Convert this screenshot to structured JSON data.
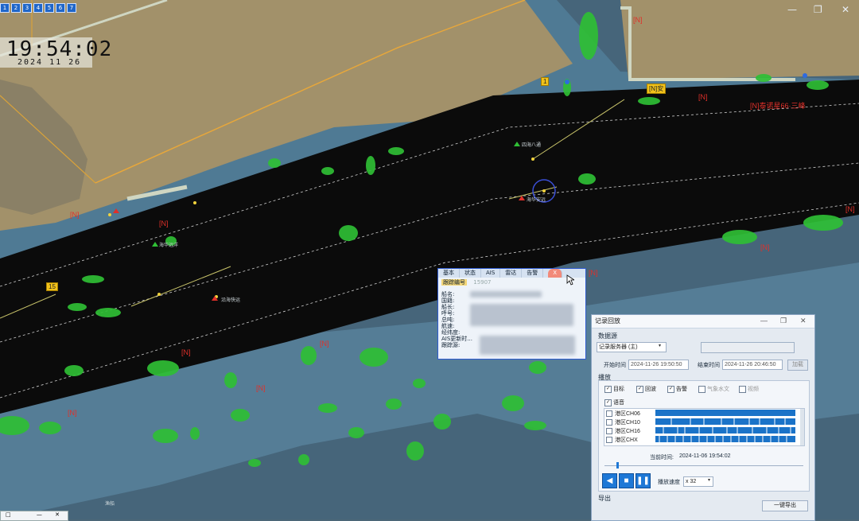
{
  "clock": {
    "time": "19:54:02",
    "date": "2024  11  26"
  },
  "toolbar": {
    "buttons": [
      "1",
      "2",
      "3",
      "4",
      "5",
      "6",
      "7"
    ]
  },
  "window_controls": {
    "minimize": "—",
    "restore": "❐",
    "close": "✕"
  },
  "map_labels": {
    "n": "[N]",
    "n_caption": "[N]泰诺星66·三峰",
    "y1": "[N]安",
    "y2": "15",
    "y3": "1",
    "t1": "四海八通",
    "t2": "海华安远",
    "t3": "海华远洋",
    "t4": "沿海快运",
    "t5": "渔船"
  },
  "popup": {
    "tabs": [
      "基本",
      "状态",
      "AIS",
      "雷达",
      "告警",
      "X"
    ],
    "id_label": "跟踪编号",
    "id_value": "15907",
    "fields": [
      "船名:",
      "国籍:",
      "船长:",
      "呼号:",
      "总吨:",
      "航速:",
      "",
      "经纬度:",
      "AIS更新时...",
      "跟踪源:"
    ]
  },
  "playback": {
    "title": "记录回放",
    "source_section": "数据源",
    "source_value": "记录服务器 (主)",
    "start_label": "开始时间",
    "start_value": "2024-11-26 19:50:50",
    "end_label": "结束时间",
    "end_value": "2024-11-26 20:46:50",
    "load_button": "加载",
    "play_section": "播放",
    "options": [
      {
        "label": "目标",
        "checked": true,
        "enabled": true
      },
      {
        "label": "回波",
        "checked": true,
        "enabled": true
      },
      {
        "label": "告警",
        "checked": true,
        "enabled": true
      },
      {
        "label": "气象水文",
        "checked": false,
        "enabled": false
      },
      {
        "label": "视频",
        "checked": false,
        "enabled": false
      }
    ],
    "voice_label": "语音",
    "voice_checked": true,
    "channels": [
      "港区CH06",
      "港区CH10",
      "港区CH16",
      "港区CHX"
    ],
    "current_time_label": "当前时间:",
    "current_time_value": "2024-11-06  19:54:02",
    "play_progress": 0.06,
    "speed_label": "播放速度",
    "speed_value": "x 32",
    "export_section": "导出",
    "export_button": "一键导出",
    "colors": {
      "accent": "#1e78d6",
      "bar": "#1b73c8"
    }
  },
  "mini_window": {
    "icons": [
      "□",
      "—",
      "✕"
    ]
  }
}
